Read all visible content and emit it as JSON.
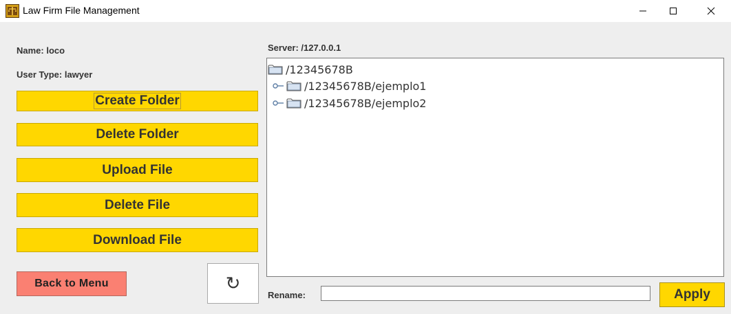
{
  "window": {
    "title": "Law Firm File Management",
    "icon": "scales-of-justice-icon"
  },
  "user": {
    "name_label": "Name: loco",
    "type_label": "User Type: lawyer"
  },
  "actions": {
    "create_folder": "Create Folder",
    "delete_folder": "Delete Folder",
    "upload_file": "Upload File",
    "delete_file": "Delete File",
    "download_file": "Download File",
    "back_to_menu": "Back to Menu",
    "refresh_icon": "↻"
  },
  "server": {
    "label": "Server: /127.0.0.1"
  },
  "tree": {
    "root": "/12345678B",
    "children": [
      "/12345678B/ejemplo1",
      "/12345678B/ejemplo2"
    ]
  },
  "rename": {
    "label": "Rename:",
    "value": "",
    "apply_label": "Apply"
  },
  "colors": {
    "action_button": "#ffd700",
    "back_button": "#fa8072",
    "background": "#eeeeee"
  }
}
